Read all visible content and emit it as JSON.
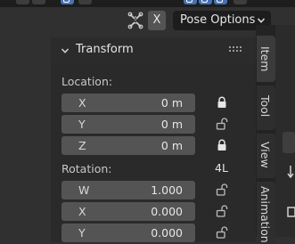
{
  "header": {
    "close_label": "X",
    "mode_dropdown": "Pose Options",
    "icons": [
      "bone-xmirror-icon",
      "chevron-down-icon"
    ]
  },
  "panel": {
    "title": "Transform",
    "location": {
      "label": "Location:",
      "rows": [
        {
          "axis": "X",
          "value": "0 m",
          "locked": true
        },
        {
          "axis": "Y",
          "value": "0 m",
          "locked": false
        },
        {
          "axis": "Z",
          "value": "0 m",
          "locked": true
        }
      ]
    },
    "rotation": {
      "label": "Rotation:",
      "mode": "4L",
      "rows": [
        {
          "axis": "W",
          "value": "1.000",
          "locked": false
        },
        {
          "axis": "X",
          "value": "0.000",
          "locked": false
        },
        {
          "axis": "Y",
          "value": "0.000",
          "locked": false
        }
      ]
    }
  },
  "tabs": [
    {
      "label": "Item",
      "active": true
    },
    {
      "label": "Tool",
      "active": false
    },
    {
      "label": "View",
      "active": false
    },
    {
      "label": "Animation",
      "active": false
    }
  ]
}
